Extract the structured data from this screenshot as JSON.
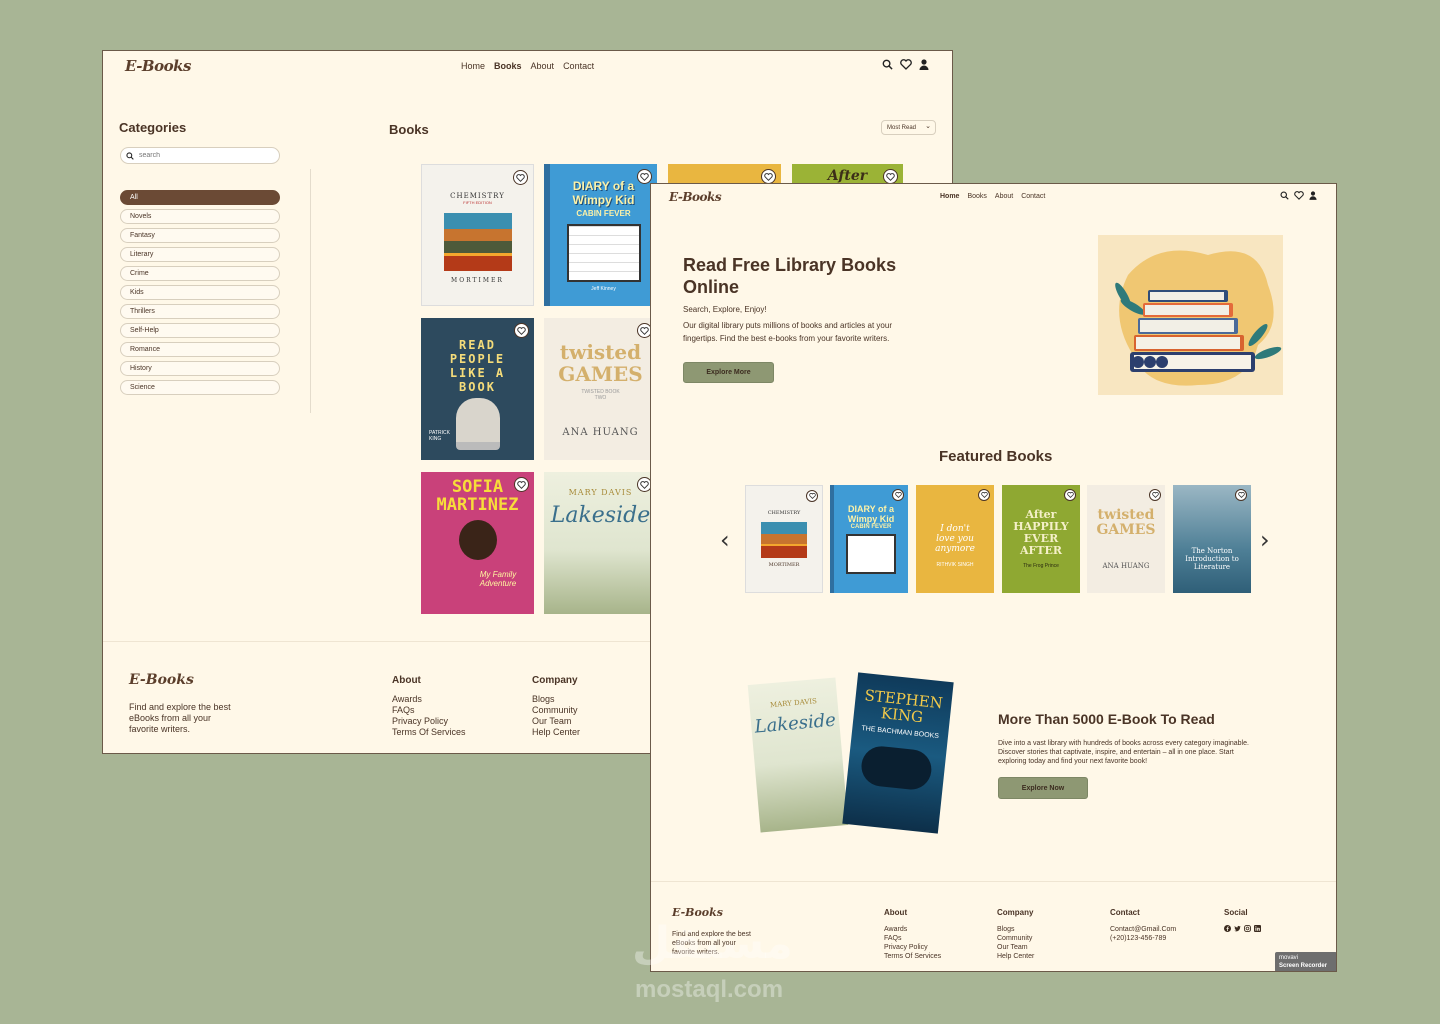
{
  "brand": "E-Books",
  "books_page": {
    "nav": [
      "Home",
      "Books",
      "About",
      "Contact"
    ],
    "nav_active": "Books",
    "categories_title": "Categories",
    "search_placeholder": "search",
    "categories": [
      "All",
      "Novels",
      "Fantasy",
      "Literary",
      "Crime",
      "Kids",
      "Thrillers",
      "Self-Help",
      "Romance",
      "History",
      "Science"
    ],
    "active_category": "All",
    "books_title": "Books",
    "sort_label": "Most Read",
    "grid": [
      {
        "title": "CHEMISTRY",
        "sub": "FIFTH EDITION",
        "author": "MORTIMER",
        "color": "#f4f2ec"
      },
      {
        "title": "DIARY of a Wimpy Kid",
        "sub": "CABIN FEVER",
        "author": "Jeff Kinney",
        "color": "#3f9bd5"
      },
      {
        "title": "",
        "sub": "",
        "author": "",
        "color": "#e9b640"
      },
      {
        "title": "After",
        "sub": "",
        "author": "",
        "color": "#9bb336"
      },
      {
        "title": "READ PEOPLE LIKE A BOOK",
        "sub": "",
        "author": "PATRICK KING",
        "color": "#2d4a5e"
      },
      {
        "title": "twisted GAMES",
        "sub": "TWISTED BOOK TWO",
        "author": "ANA HUANG",
        "color": "#f3ede2"
      },
      {
        "title": "SOFIA MARTINEZ",
        "sub": "My Family Adventure",
        "author": "",
        "color": "#c9417a"
      },
      {
        "title": "Lakeside",
        "sub": "",
        "author": "MARY DAVIS",
        "color": "#dfe5cf"
      }
    ],
    "footer": {
      "desc": [
        "Find and explore the best",
        "eBooks from all your",
        "favorite writers."
      ],
      "about_title": "About",
      "about_links": [
        "Awards",
        "FAQs",
        "Privacy Policy",
        "Terms Of Services"
      ],
      "company_title": "Company",
      "company_links": [
        "Blogs",
        "Community",
        "Our Team",
        "Help Center"
      ]
    }
  },
  "home_page": {
    "nav": [
      "Home",
      "Books",
      "About",
      "Contact"
    ],
    "nav_active": "Home",
    "hero_title_1": "Read Free Library Books",
    "hero_title_2": "Online",
    "hero_sub": "Search, Explore, Enjoy!",
    "hero_desc_1": "Our digital library puts millions of books and articles at your",
    "hero_desc_2": "fingertips. Find the best e-books from your favorite writers.",
    "hero_button": "Explore More",
    "featured_title": "Featured Books",
    "featured": [
      {
        "title": "CHEMISTRY",
        "author": "MORTIMER",
        "color": "#f4f2ec"
      },
      {
        "title": "DIARY of a Wimpy Kid",
        "author": "CABIN FEVER",
        "color": "#3f9bd5"
      },
      {
        "title": "I don't love you anymore",
        "author": "RITHVIK SINGH",
        "color": "#e9b640"
      },
      {
        "title": "After HAPPILY EVER AFTER",
        "author": "The Frog Prince",
        "color": "#8fa832"
      },
      {
        "title": "twisted GAMES",
        "author": "ANA HUANG",
        "color": "#f3ede2"
      },
      {
        "title": "The Norton Introduction to Literature",
        "author": "",
        "color": "#6d97a8"
      }
    ],
    "promo_books": [
      {
        "title": "Lakeside",
        "author": "MARY DAVIS"
      },
      {
        "title": "STEPHEN KING",
        "author": "THE BACHMAN BOOKS"
      }
    ],
    "promo_title": "More Than 5000 E-Book To Read",
    "promo_desc": [
      "Dive into a vast library with hundreds of books across every category imaginable.",
      "Discover stories that captivate, inspire, and entertain – all in one place. Start",
      "exploring today and find your next favorite book!"
    ],
    "promo_button": "Explore Now",
    "footer": {
      "desc": [
        "Find and explore the best",
        "eBooks from all your",
        "favorite writers."
      ],
      "about_title": "About",
      "about_links": [
        "Awards",
        "FAQs",
        "Privacy Policy",
        "Terms Of Services"
      ],
      "company_title": "Company",
      "company_links": [
        "Blogs",
        "Community",
        "Our Team",
        "Help Center"
      ],
      "contact_title": "Contact",
      "contact_email": "Contact@Gmail.Com",
      "contact_phone": "(+20)123-456-789",
      "social_title": "Social",
      "social_icons": [
        "facebook-icon",
        "twitter-icon",
        "instagram-icon",
        "linkedin-icon"
      ]
    }
  },
  "overlay": {
    "recorder_1": "movavi",
    "recorder_2": "Screen Recorder",
    "watermark_ar": "مستقل",
    "watermark": "mostaql.com"
  },
  "colors": {
    "bg": "#a8b595",
    "page": "#fff8e8",
    "brown": "#6b4a35",
    "button": "#8e9873"
  }
}
